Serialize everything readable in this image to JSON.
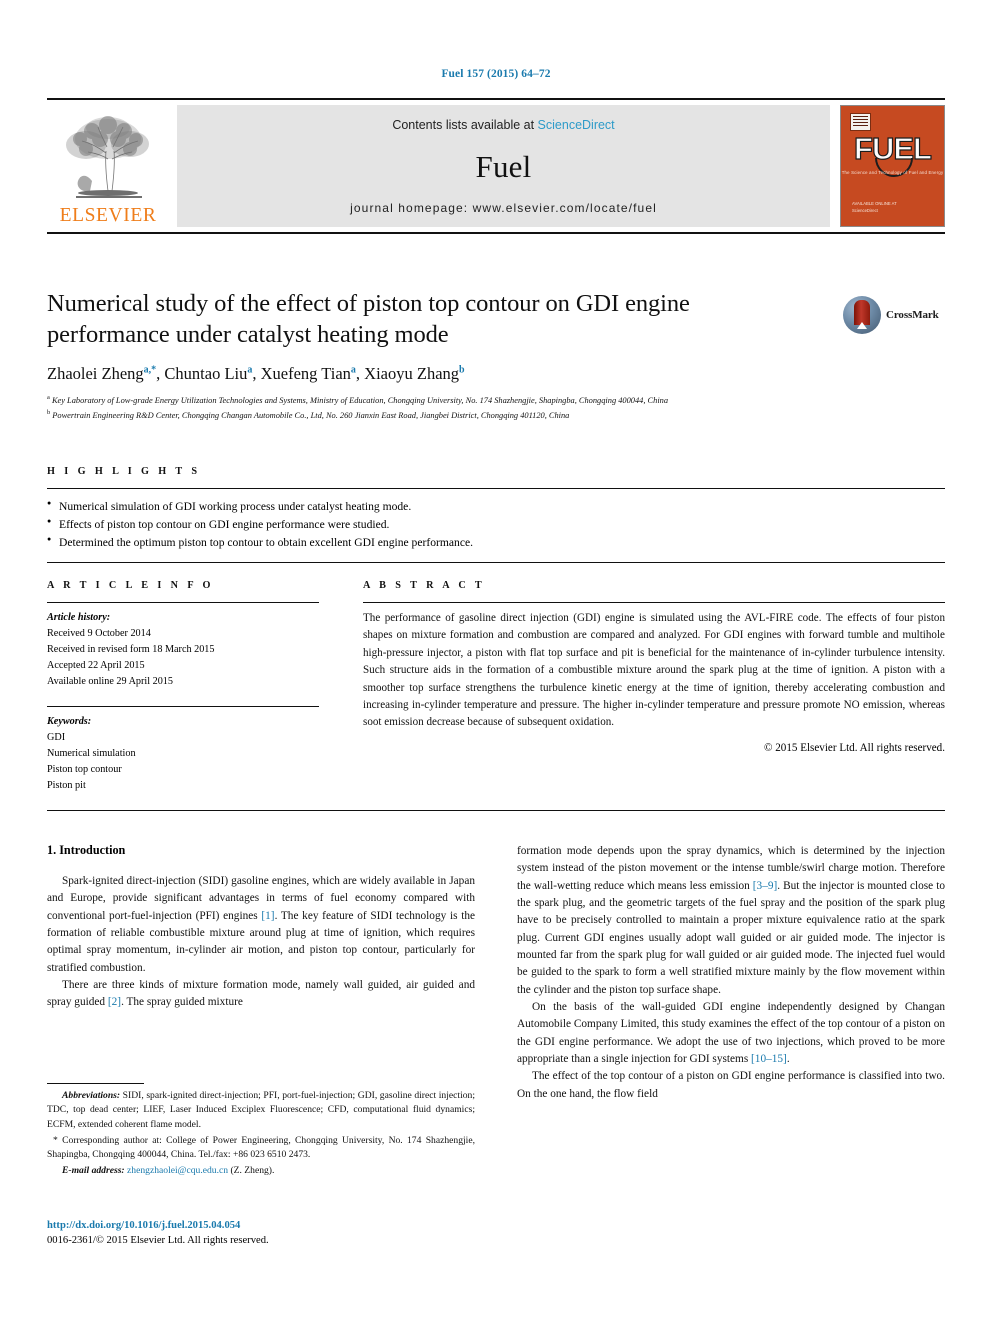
{
  "running_head": "Fuel 157 (2015) 64–72",
  "masthead": {
    "contents_prefix": "Contents lists available at ",
    "sciencedirect": "ScienceDirect",
    "journal_title": "Fuel",
    "homepage": "journal homepage: www.elsevier.com/locate/fuel",
    "publisher_wordmark": "ELSEVIER",
    "cover": {
      "wordmark": "FUEL",
      "subtitle": "The Science and Technology of Fuel and Energy",
      "footer_line1": "AVAILABLE ONLINE AT",
      "footer_line2": "ScienceDirect"
    }
  },
  "article": {
    "title": "Numerical study of the effect of piston top contour on GDI engine performance under catalyst heating mode",
    "crossmark_label": "CrossMark",
    "authors_html": "Zhaolei Zheng<sup>a,*</sup>, Chuntao Liu<sup>a</sup>, Xuefeng Tian<sup>a</sup>, Xiaoyu Zhang<sup>b</sup>",
    "affiliations": [
      "Key Laboratory of Low-grade Energy Utilization Technologies and Systems, Ministry of Education, Chongqing University, No. 174 Shazhengjie, Shapingba, Chongqing 400044, China",
      "Powertrain Engineering R&D Center, Chongqing Changan Automobile Co., Ltd, No. 260 Jianxin East Road, Jiangbei District, Chongqing 401120, China"
    ],
    "affiliation_marks": [
      "a",
      "b"
    ]
  },
  "highlights": {
    "heading": "H I G H L I G H T S",
    "items": [
      "Numerical simulation of GDI working process under catalyst heating mode.",
      "Effects of piston top contour on GDI engine performance were studied.",
      "Determined the optimum piston top contour to obtain excellent GDI engine performance."
    ]
  },
  "article_info": {
    "heading": "A R T I C L E   I N F O",
    "history_label": "Article history:",
    "history": [
      "Received 9 October 2014",
      "Received in revised form 18 March 2015",
      "Accepted 22 April 2015",
      "Available online 29 April 2015"
    ],
    "keywords_label": "Keywords:",
    "keywords": [
      "GDI",
      "Numerical simulation",
      "Piston top contour",
      "Piston pit"
    ]
  },
  "abstract": {
    "heading": "A B S T R A C T",
    "text": "The performance of gasoline direct injection (GDI) engine is simulated using the AVL-FIRE code. The effects of four piston shapes on mixture formation and combustion are compared and analyzed. For GDI engines with forward tumble and multihole high-pressure injector, a piston with flat top surface and pit is beneficial for the maintenance of in-cylinder turbulence intensity. Such structure aids in the formation of a combustible mixture around the spark plug at the time of ignition. A piston with a smoother top surface strengthens the turbulence kinetic energy at the time of ignition, thereby accelerating combustion and increasing in-cylinder temperature and pressure. The higher in-cylinder temperature and pressure promote NO emission, whereas soot emission decrease because of subsequent oxidation.",
    "copyright": "© 2015 Elsevier Ltd. All rights reserved."
  },
  "body": {
    "section_heading": "1. Introduction",
    "left_para_1_a": "Spark-ignited direct-injection (SIDI) gasoline engines, which are widely available in Japan and Europe, provide significant advantages in terms of fuel economy compared with conventional port-fuel-injection (PFI) engines ",
    "left_para_1_ref": "[1]",
    "left_para_1_b": ". The key feature of SIDI technology is the formation of reliable combustible mixture around plug at time of ignition, which requires optimal spray momentum, in-cylinder air motion, and piston top contour, particularly for stratified combustion.",
    "left_para_2_a": "There are three kinds of mixture formation mode, namely wall guided, air guided and spray guided ",
    "left_para_2_ref": "[2]",
    "left_para_2_b": ". The spray guided mixture",
    "right_para_1_a": "formation mode depends upon the spray dynamics, which is determined by the injection system instead of the piston movement or the intense tumble/swirl charge motion. Therefore the wall-wetting reduce which means less emission ",
    "right_para_1_ref": "[3–9]",
    "right_para_1_b": ". But the injector is mounted close to the spark plug, and the geometric targets of the fuel spray and the position of the spark plug have to be precisely controlled to maintain a proper mixture equivalence ratio at the spark plug. Current GDI engines usually adopt wall guided or air guided mode. The injector is mounted far from the spark plug for wall guided or air guided mode. The injected fuel would be guided to the spark to form a well stratified mixture mainly by the flow movement within the cylinder and the piston top surface shape.",
    "right_para_2_a": "On the basis of the wall-guided GDI engine independently designed by Changan Automobile Company Limited, this study examines the effect of the top contour of a piston on the GDI engine performance. We adopt the use of two injections, which proved to be more appropriate than a single injection for GDI systems ",
    "right_para_2_ref": "[10–15]",
    "right_para_2_b": ".",
    "right_para_3": "The effect of the top contour of a piston on GDI engine performance is classified into two. On the one hand, the flow field"
  },
  "footnotes": {
    "abbreviations_label": "Abbreviations:",
    "abbreviations_text": " SIDI, spark-ignited direct-injection; PFI, port-fuel-injection; GDI, gasoline direct injection; TDC, top dead center; LIEF, Laser Induced Exciplex Fluorescence; CFD, computational fluid dynamics; ECFM, extended coherent flame model.",
    "corresponding_text": "* Corresponding author at: College of Power Engineering, Chongqing University, No. 174 Shazhengjie, Shapingba, Chongqing 400044, China. Tel./fax: +86 023 6510 2473.",
    "email_label": "E-mail address:",
    "email": "zhengzhaolei@cqu.edu.cn",
    "email_suffix": " (Z. Zheng)."
  },
  "doi": {
    "url": "http://dx.doi.org/10.1016/j.fuel.2015.04.054",
    "issn_line": "0016-2361/© 2015 Elsevier Ltd. All rights reserved."
  },
  "colors": {
    "link_blue": "#1a7aad",
    "sciencedirect_blue": "#2e9bc9",
    "elsevier_orange": "#ef7d1a",
    "cover_orange": "#c64a21",
    "band_grey": "#e4e4e4"
  }
}
